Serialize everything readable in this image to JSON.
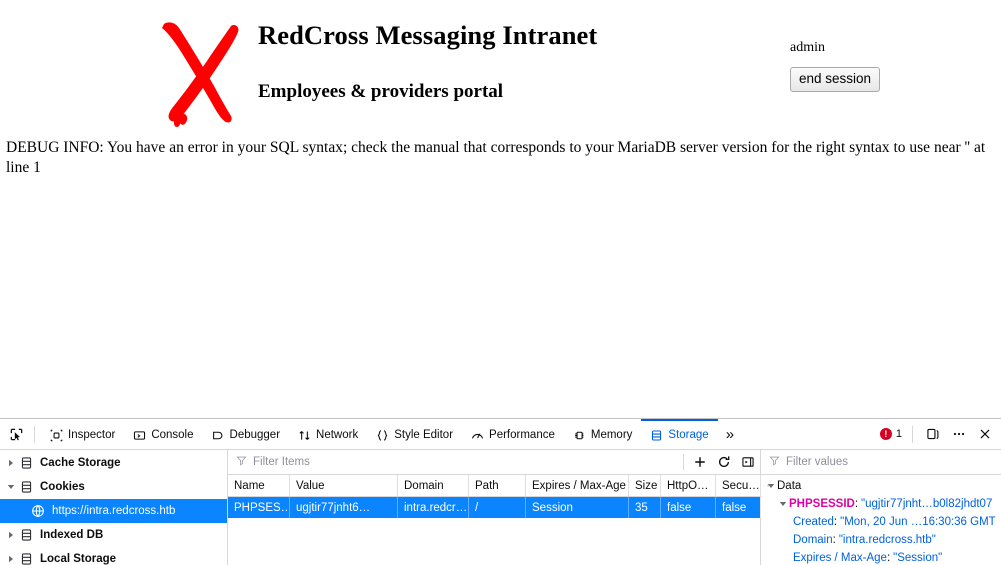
{
  "page": {
    "logo_alt": "red-x-logo",
    "logo_color": "#fe0000",
    "title": "RedCross Messaging Intranet",
    "subtitle": "Employees & providers portal",
    "user": "admin",
    "end_session_label": "end session",
    "debug_message": "DEBUG INFO: You have an error in your SQL syntax; check the manual that corresponds to your MariaDB server version for the right syntax to use near '' at line 1"
  },
  "devtools": {
    "tabs": [
      {
        "label": "Inspector",
        "icon": "inspector-icon",
        "active": false
      },
      {
        "label": "Console",
        "icon": "console-icon",
        "active": false
      },
      {
        "label": "Debugger",
        "icon": "debugger-icon",
        "active": false
      },
      {
        "label": "Network",
        "icon": "network-icon",
        "active": false
      },
      {
        "label": "Style Editor",
        "icon": "style-editor-icon",
        "active": false
      },
      {
        "label": "Performance",
        "icon": "performance-icon",
        "active": false
      },
      {
        "label": "Memory",
        "icon": "memory-icon",
        "active": false
      },
      {
        "label": "Storage",
        "icon": "storage-icon",
        "active": true
      }
    ],
    "overflow_label": "»",
    "error_count": "1",
    "error_badge_glyph": "!",
    "accent_color": "#0060df",
    "selection_color": "#0a84ff",
    "error_color": "#d70022"
  },
  "storage": {
    "sidebar": [
      {
        "label": "Cache Storage",
        "expanded": false,
        "selected": false,
        "icon": "database-icon"
      },
      {
        "label": "Cookies",
        "expanded": true,
        "selected": false,
        "icon": "database-icon"
      },
      {
        "label": "https://intra.redcross.htb",
        "child": true,
        "selected": true,
        "icon": "globe-icon"
      },
      {
        "label": "Indexed DB",
        "expanded": false,
        "selected": false,
        "icon": "database-icon"
      },
      {
        "label": "Local Storage",
        "expanded": false,
        "selected": false,
        "icon": "database-icon"
      }
    ],
    "filter_items_placeholder": "Filter Items",
    "toolbar": {
      "add_label": "+",
      "refresh_icon": "refresh-icon",
      "sidebar_toggle_icon": "panel-toggle-icon"
    },
    "columns": [
      "Name",
      "Value",
      "Domain",
      "Path",
      "Expires / Max-Age",
      "Size",
      "HttpO…",
      "Secu…"
    ],
    "rows": [
      {
        "name": "PHPSES…",
        "value": "ugjtir77jnht6…",
        "domain": "intra.redcr…",
        "path": "/",
        "expires": "Session",
        "size": "35",
        "httponly": "false",
        "secure": "false"
      }
    ]
  },
  "values": {
    "filter_placeholder": "Filter values",
    "root_label": "Data",
    "cookie_key": "PHPSESSID",
    "cookie_value": "\"ugjtir77jnht…b0l82jhdt07",
    "details": [
      {
        "key": "Created",
        "value": "\"Mon, 20 Jun …16:30:36 GMT"
      },
      {
        "key": "Domain",
        "value": "\"intra.redcross.htb\""
      },
      {
        "key": "Expires / Max-Age",
        "value": "\"Session\""
      }
    ]
  }
}
